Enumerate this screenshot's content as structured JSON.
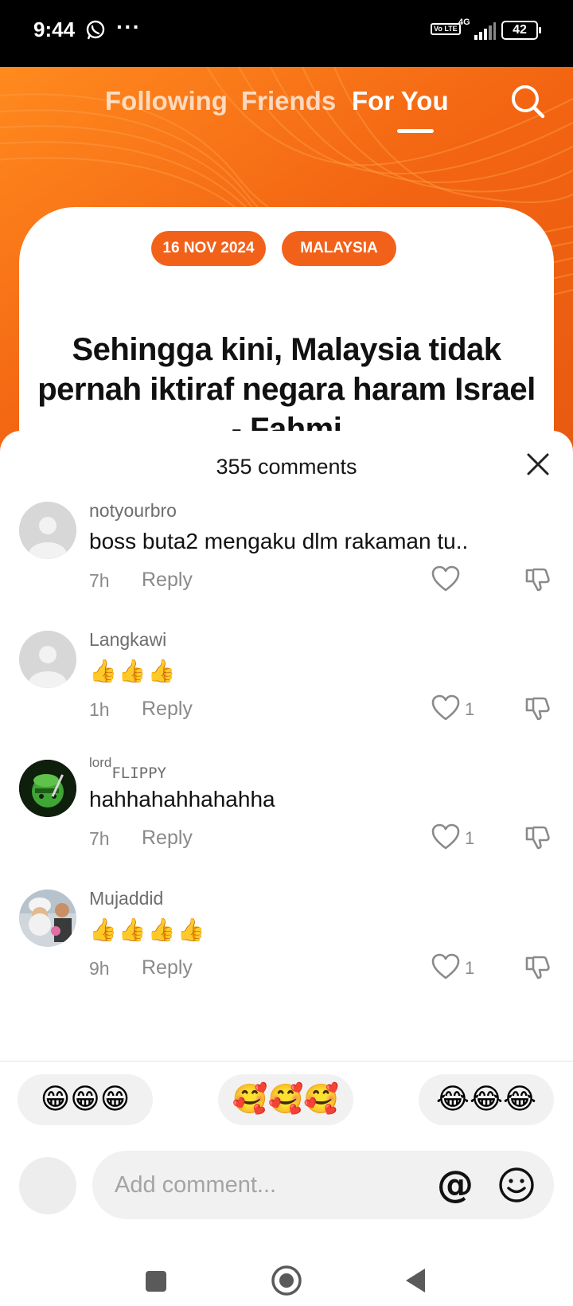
{
  "status_bar": {
    "time": "9:44",
    "dots": "···",
    "volte": "Vo LTE",
    "network": "4G",
    "battery": "42"
  },
  "top_nav": {
    "tabs": [
      {
        "label": "Following"
      },
      {
        "label": "Friends"
      },
      {
        "label": "For You"
      }
    ],
    "active_tab": "For You"
  },
  "video": {
    "tags": [
      "16 NOV 2024",
      "MALAYSIA"
    ],
    "headline": "Sehingga kini, Malaysia tidak pernah iktiraf negara haram Israel - Fahmi",
    "accent_color": "#f26a13"
  },
  "comments_sheet": {
    "title": "355 comments",
    "comments": [
      {
        "user": "notyourbro",
        "text": "boss buta2 mengaku dlm rakaman tu..",
        "time": "7h",
        "reply": "Reply",
        "likes": ""
      },
      {
        "user": "Langkawi",
        "text": "👍👍👍",
        "time": "1h",
        "reply": "Reply",
        "likes": "1"
      },
      {
        "user": "lordFLIPPY",
        "user_prefix": "lord",
        "user_suffix": "FLIPPY",
        "text": "hahhahahhahahha",
        "time": "7h",
        "reply": "Reply",
        "likes": "1"
      },
      {
        "user": "Mujaddid",
        "text": "👍👍👍👍",
        "time": "9h",
        "reply": "Reply",
        "likes": "1"
      }
    ],
    "quick_emojis": [
      "😁😁😁",
      "🥰🥰🥰",
      "😂😂😂"
    ],
    "input_placeholder": "Add comment..."
  }
}
